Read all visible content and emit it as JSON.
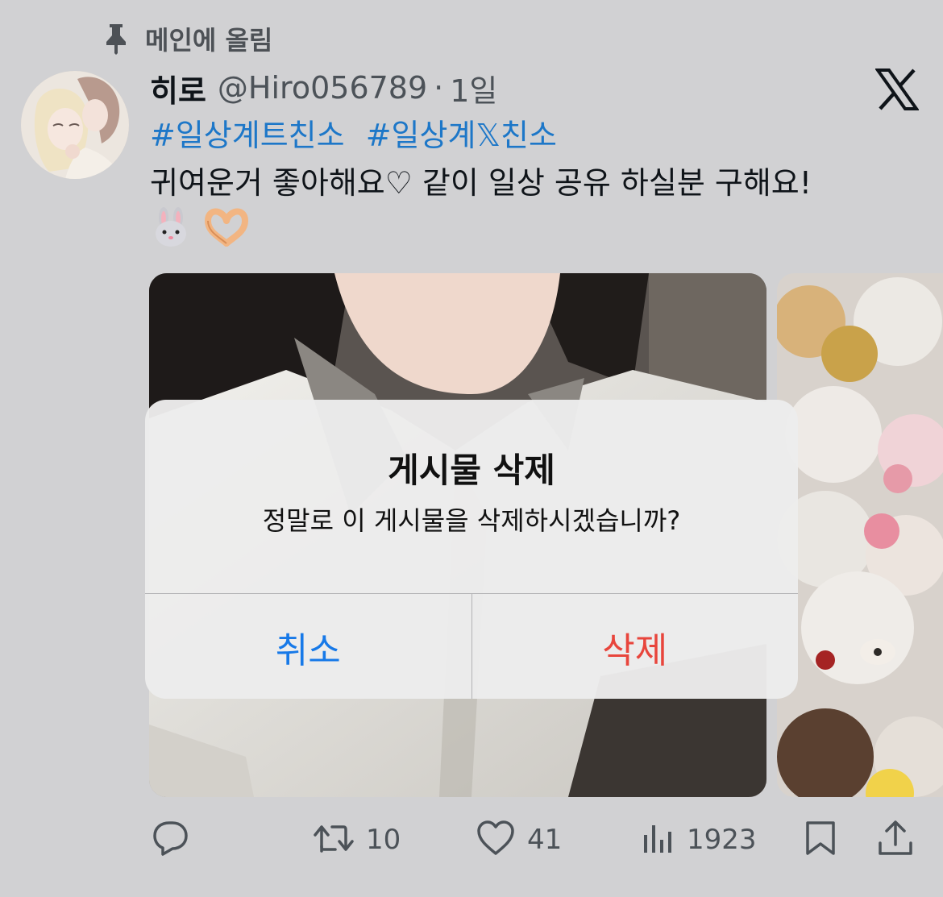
{
  "pinned": {
    "label": "메인에 올림",
    "icon": "pin-icon"
  },
  "tweet": {
    "display_name": "히로",
    "handle": "@Hiro056789",
    "separator": "·",
    "time": "1일",
    "hashtags": [
      "#일상계트친소",
      "#일상계𝕏친소"
    ],
    "text": "귀여운거 좋아해요♡ 같이 일상 공유 하실분 구해요!",
    "emojis": [
      "🐰",
      "🫶"
    ]
  },
  "actions": {
    "reply": {
      "icon": "reply-icon",
      "count": ""
    },
    "retweet": {
      "icon": "retweet-icon",
      "count": "10"
    },
    "like": {
      "icon": "heart-icon",
      "count": "41"
    },
    "views": {
      "icon": "views-icon",
      "count": "1923"
    },
    "bookmark": {
      "icon": "bookmark-icon"
    },
    "share": {
      "icon": "share-icon"
    }
  },
  "dialog": {
    "title": "게시물 삭제",
    "message": "정말로 이 게시물을 삭제하시겠습니까?",
    "cancel_label": "취소",
    "delete_label": "삭제"
  },
  "colors": {
    "hashtag": "#1d77c8",
    "cancel": "#1779e8",
    "destructive": "#e8453c",
    "overlay_background": "#d1d1d3"
  }
}
